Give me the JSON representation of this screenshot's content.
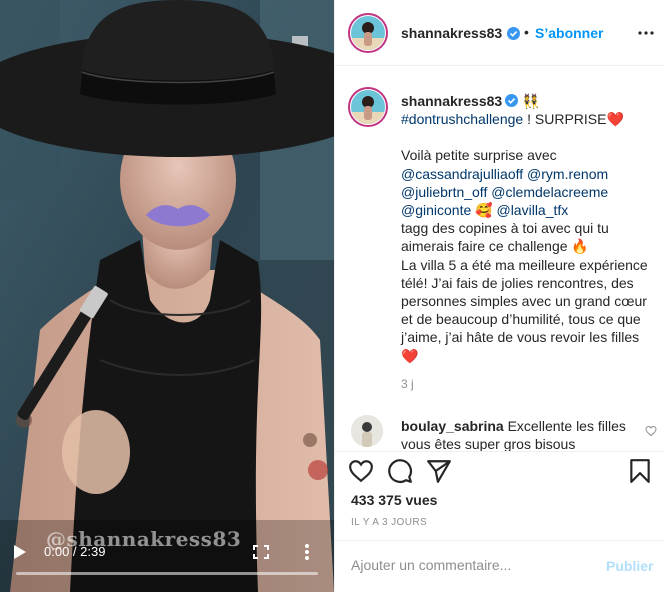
{
  "video": {
    "time_display": "0:00 / 2:39",
    "progress": 0.0,
    "watermark": "@shannakress83",
    "controls": {
      "play_icon": "play-icon",
      "fullscreen_icon": "fullscreen-icon",
      "more_icon": "more-vertical-icon"
    }
  },
  "header": {
    "username": "shannakress83",
    "verified_icon": "verified-badge-icon",
    "separator": "•",
    "follow_label": "S’abonner",
    "more_icon": "more-horizontal-icon"
  },
  "caption": {
    "username": "shannakress83",
    "emoji_after_name": "👯",
    "line1_hashtag": "#dontrushchallenge",
    "line1_rest": " ! SURPRISE❤️",
    "intro": "Voilà petite surprise avec",
    "mentions_line1": [
      "@cassandrajulliaoff",
      "@rym.renom"
    ],
    "mentions_line2": [
      "@juliebrtn_off",
      "@clemdelacreeme"
    ],
    "mentions_line3a": "@giniconte",
    "mentions_line3_emoji": "🥰",
    "mentions_line3b": "@lavilla_tfx",
    "tag_text": "tagg des copines à toi avec qui tu aimerais faire ce challenge 🔥",
    "body_text": "La villa 5 a été ma meilleure expérience télé! J’ai fais de jolies rencontres, des personnes simples avec un grand cœur et de beaucoup d’humilité, tous ce que j’aime, j’ai hâte de vous revoir les filles ❤️",
    "time_ago": "3 j"
  },
  "comments": [
    {
      "username": "boulay_sabrina",
      "text": "Excellente les filles vous êtes super gros bisous"
    }
  ],
  "actions": {
    "icons": [
      "heart-icon",
      "comment-icon",
      "share-icon",
      "bookmark-icon"
    ],
    "views": "433 375 vues",
    "date": "IL Y A 3 JOURS"
  },
  "add_comment": {
    "placeholder": "Ajouter un commentaire...",
    "publish_label": "Publier"
  },
  "colors": {
    "link": "#00376b",
    "follow": "#0095f6",
    "muted": "#8e8e8e",
    "publish_disabled": "#b2dffc",
    "border": "#efefef"
  }
}
